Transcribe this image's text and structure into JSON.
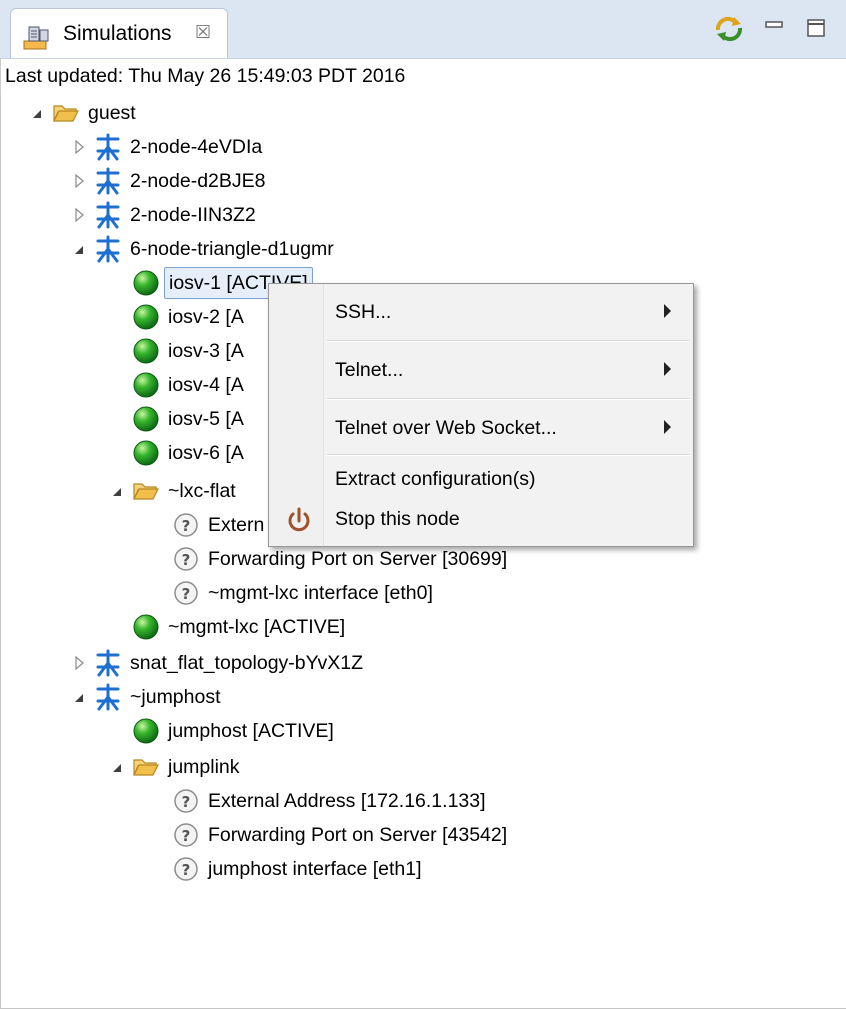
{
  "tab": {
    "title": "Simulations",
    "close": "☒"
  },
  "status": "Last updated: Thu May 26 15:49:03 PDT 2016",
  "tree": {
    "guest": "guest",
    "sim1": "2-node-4eVDIa",
    "sim2": "2-node-d2BJE8",
    "sim3": "2-node-IIN3Z2",
    "sim4": "6-node-triangle-d1ugmr",
    "iosv1": "iosv-1 [ACTIVE]",
    "iosv2": "iosv-2 [A",
    "iosv3": "iosv-3 [A",
    "iosv4": "iosv-4 [A",
    "iosv5": "iosv-5 [A",
    "iosv6": "iosv-6 [A",
    "lxcflat": "~lxc-flat",
    "extern": "Extern",
    "fwd1": "Forwarding Port on Server [30699]",
    "mgmtif": "~mgmt-lxc interface [eth0]",
    "mgmtlxc": "~mgmt-lxc [ACTIVE]",
    "snat": "snat_flat_topology-bYvX1Z",
    "jumphostgrp": "~jumphost",
    "jumphost": "jumphost [ACTIVE]",
    "jumplink": "jumplink",
    "extaddr": "External Address [172.16.1.133]",
    "fwd2": "Forwarding Port on Server [43542]",
    "jhif": "jumphost interface [eth1]"
  },
  "menu": {
    "ssh": "SSH...",
    "telnet": "Telnet...",
    "telnet_ws": "Telnet over Web Socket...",
    "extract": "Extract configuration(s)",
    "stop": "Stop this node"
  },
  "icons": {
    "tab": "server-icon",
    "sync": "sync-icon",
    "minimize": "minimize-icon",
    "maximize": "maximize-icon",
    "folder": "folder-icon",
    "topology": "topology-icon",
    "node_active": "green-ball-icon",
    "unknown": "question-icon",
    "power": "power-icon"
  },
  "colors": {
    "active_green": "#2fa82f",
    "topology_blue": "#1f6fd1",
    "folder_yellow": "#f0c04a",
    "selection": "#e5eef9",
    "power_brown": "#a0522d"
  }
}
